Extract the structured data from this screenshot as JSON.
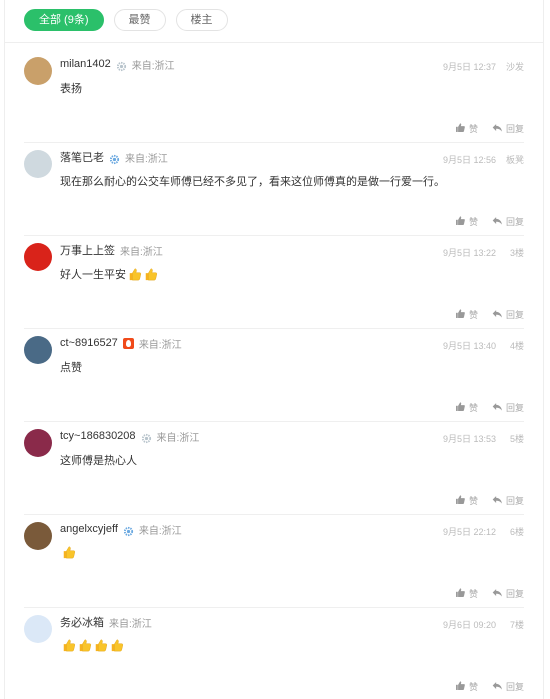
{
  "tabs": [
    {
      "label": "全部 (9条)",
      "active": true
    },
    {
      "label": "最赞",
      "active": false
    },
    {
      "label": "楼主",
      "active": false
    }
  ],
  "actions": {
    "like_label": "赞",
    "reply_label": "回复"
  },
  "comments": [
    {
      "name": "milan1402",
      "badge": "gear-badge",
      "from": "来自:浙江",
      "time": "9月5日 12:37",
      "floor": "沙发",
      "text": "表扬",
      "thumbs": 0,
      "avatar_color": "#c9a06a"
    },
    {
      "name": "落笔已老",
      "badge": "blue-gear-badge",
      "from": "来自:浙江",
      "time": "9月5日 12:56",
      "floor": "板凳",
      "text": "现在那么耐心的公交车师傅已经不多见了，看来这位师傅真的是做一行爱一行。",
      "thumbs": 0,
      "avatar_color": "#cfd9df"
    },
    {
      "name": "万事上上签",
      "badge": "",
      "from": "来自:浙江",
      "time": "9月5日 13:22",
      "floor": "3楼",
      "text": "好人一生平安",
      "thumbs": 2,
      "avatar_color": "#d9231a"
    },
    {
      "name": "ct~8916527",
      "badge": "fire-badge",
      "from": "来自:浙江",
      "time": "9月5日 13:40",
      "floor": "4楼",
      "text": "点赞",
      "thumbs": 0,
      "avatar_color": "#4a6a86"
    },
    {
      "name": "tcy~186830208",
      "badge": "gear-badge",
      "from": "来自:浙江",
      "time": "9月5日 13:53",
      "floor": "5楼",
      "text": "这师傅是热心人",
      "thumbs": 0,
      "avatar_color": "#8a2a4a"
    },
    {
      "name": "angelxcyjeff",
      "badge": "blue-gear-badge",
      "from": "来自:浙江",
      "time": "9月5日 22:12",
      "floor": "6楼",
      "text": "",
      "thumbs": 1,
      "avatar_color": "#7a5a3a"
    },
    {
      "name": "务必冰箱",
      "badge": "",
      "from": "来自:浙江",
      "time": "9月6日 09:20",
      "floor": "7楼",
      "text": "",
      "thumbs": 4,
      "avatar_color": "#dbe8f7"
    }
  ]
}
